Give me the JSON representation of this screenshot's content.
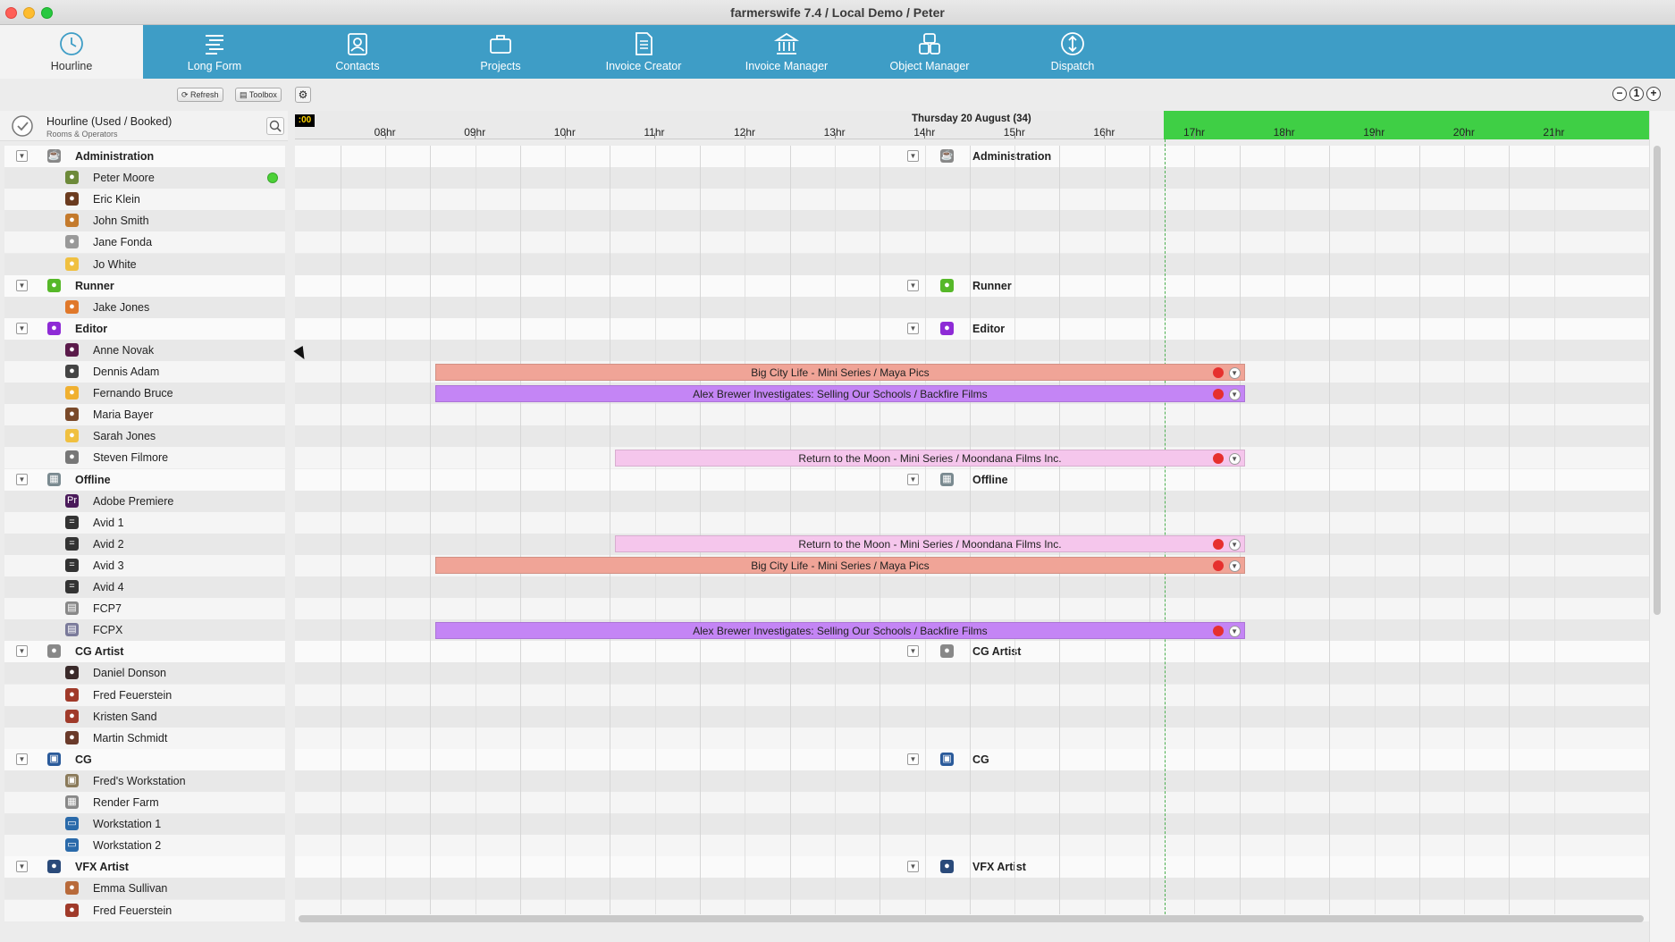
{
  "window": {
    "title": "farmerswife 7.4  / Local Demo / Peter"
  },
  "nav": {
    "tabs": [
      {
        "label": "Hourline",
        "icon": "clock-icon",
        "active": true
      },
      {
        "label": "Long Form",
        "icon": "long-form-icon"
      },
      {
        "label": "Contacts",
        "icon": "contacts-icon"
      },
      {
        "label": "Projects",
        "icon": "briefcase-icon"
      },
      {
        "label": "Invoice Creator",
        "icon": "document-icon"
      },
      {
        "label": "Invoice Manager",
        "icon": "bank-icon"
      },
      {
        "label": "Object Manager",
        "icon": "objects-icon"
      },
      {
        "label": "Dispatch",
        "icon": "dispatch-icon"
      }
    ]
  },
  "toolbar": {
    "refresh_label": "Refresh",
    "toolbox_label": "Toolbox",
    "zoom_out": "−",
    "zoom_reset": "1",
    "zoom_in": "+"
  },
  "hourline": {
    "title": "Hourline (Used / Booked)",
    "subtitle": "Rooms & Operators",
    "now_label": ":00",
    "date": "Thursday 20 August (34)",
    "hours": [
      "08hr",
      "09hr",
      "10hr",
      "11hr",
      "12hr",
      "13hr",
      "14hr",
      "15hr",
      "16hr",
      "17hr",
      "18hr",
      "19hr",
      "20hr",
      "21hr"
    ]
  },
  "rows": [
    {
      "type": "group",
      "label": "Administration",
      "color": "#888888",
      "glyph": "☕"
    },
    {
      "type": "item",
      "label": "Peter Moore",
      "color": "#6d8a3a",
      "glyph": "●",
      "online": true
    },
    {
      "type": "item",
      "label": "Eric Klein",
      "color": "#6b3b1f",
      "glyph": "●"
    },
    {
      "type": "item",
      "label": "John Smith",
      "color": "#c47a2c",
      "glyph": "●"
    },
    {
      "type": "item",
      "label": "Jane Fonda",
      "color": "#999999",
      "glyph": "●"
    },
    {
      "type": "item",
      "label": "Jo White",
      "color": "#f0c040",
      "glyph": "●"
    },
    {
      "type": "group",
      "label": "Runner",
      "color": "#56b829",
      "glyph": "●"
    },
    {
      "type": "item",
      "label": "Jake Jones",
      "color": "#e0782a",
      "glyph": "●"
    },
    {
      "type": "group",
      "label": "Editor",
      "color": "#8e2bd6",
      "glyph": "●"
    },
    {
      "type": "item",
      "label": "Anne Novak",
      "color": "#5a1a4a",
      "glyph": "●"
    },
    {
      "type": "item",
      "label": "Dennis Adam",
      "color": "#444444",
      "glyph": "●"
    },
    {
      "type": "item",
      "label": "Fernando Bruce",
      "color": "#f0b030",
      "glyph": "●"
    },
    {
      "type": "item",
      "label": "Maria Bayer",
      "color": "#7a4a2a",
      "glyph": "●"
    },
    {
      "type": "item",
      "label": "Sarah Jones",
      "color": "#f0c040",
      "glyph": "●"
    },
    {
      "type": "item",
      "label": "Steven Filmore",
      "color": "#777777",
      "glyph": "●"
    },
    {
      "type": "group",
      "label": "Offline",
      "color": "#7a8a90",
      "glyph": "▦"
    },
    {
      "type": "item",
      "label": "Adobe Premiere",
      "color": "#4a1a5a",
      "glyph": "Pr"
    },
    {
      "type": "item",
      "label": "Avid 1",
      "color": "#333333",
      "glyph": "="
    },
    {
      "type": "item",
      "label": "Avid 2",
      "color": "#333333",
      "glyph": "="
    },
    {
      "type": "item",
      "label": "Avid 3",
      "color": "#333333",
      "glyph": "="
    },
    {
      "type": "item",
      "label": "Avid 4",
      "color": "#333333",
      "glyph": "="
    },
    {
      "type": "item",
      "label": "FCP7",
      "color": "#888888",
      "glyph": "▤"
    },
    {
      "type": "item",
      "label": "FCPX",
      "color": "#7a7a9a",
      "glyph": "▤"
    },
    {
      "type": "group",
      "label": "CG Artist",
      "color": "#888888",
      "glyph": "●"
    },
    {
      "type": "item",
      "label": "Daniel Donson",
      "color": "#3a2a2a",
      "glyph": "●"
    },
    {
      "type": "item",
      "label": "Fred Feuerstein",
      "color": "#a03a2a",
      "glyph": "●"
    },
    {
      "type": "item",
      "label": "Kristen Sand",
      "color": "#a03a2a",
      "glyph": "●"
    },
    {
      "type": "item",
      "label": "Martin Schmidt",
      "color": "#6a3a2a",
      "glyph": "●"
    },
    {
      "type": "group",
      "label": "CG",
      "color": "#2a5a9a",
      "glyph": "▣"
    },
    {
      "type": "item",
      "label": "Fred's Workstation",
      "color": "#8a7a5a",
      "glyph": "▣"
    },
    {
      "type": "item",
      "label": "Render Farm",
      "color": "#888888",
      "glyph": "▦"
    },
    {
      "type": "item",
      "label": "Workstation 1",
      "color": "#2a6aaa",
      "glyph": "▭"
    },
    {
      "type": "item",
      "label": "Workstation 2",
      "color": "#2a6aaa",
      "glyph": "▭"
    },
    {
      "type": "group",
      "label": "VFX Artist",
      "color": "#2a4a7a",
      "glyph": "●"
    },
    {
      "type": "item",
      "label": "Emma Sullivan",
      "color": "#b86a3a",
      "glyph": "●"
    },
    {
      "type": "item",
      "label": "Fred Feuerstein",
      "color": "#a03a2a",
      "glyph": "●"
    }
  ],
  "bookings": [
    {
      "row": 10,
      "label": "Big City Life - Mini Series / Maya Pics",
      "color": "red",
      "start": 9.0,
      "end": 18.0
    },
    {
      "row": 11,
      "label": "Alex Brewer Investigates: Selling Our Schools / Backfire Films",
      "color": "purple",
      "start": 9.0,
      "end": 18.0
    },
    {
      "row": 14,
      "label": "Return to the Moon - Mini Series / Moondana Films Inc.",
      "color": "pink",
      "start": 11.0,
      "end": 18.0
    },
    {
      "row": 18,
      "label": "Return to the Moon - Mini Series / Moondana Films Inc.",
      "color": "pink",
      "start": 11.0,
      "end": 18.0
    },
    {
      "row": 19,
      "label": "Big City Life - Mini Series / Maya Pics",
      "color": "red",
      "start": 9.0,
      "end": 18.0
    },
    {
      "row": 22,
      "label": "Alex Brewer Investigates: Selling Our Schools / Backfire Films",
      "color": "purple",
      "start": 9.0,
      "end": 18.0
    }
  ]
}
